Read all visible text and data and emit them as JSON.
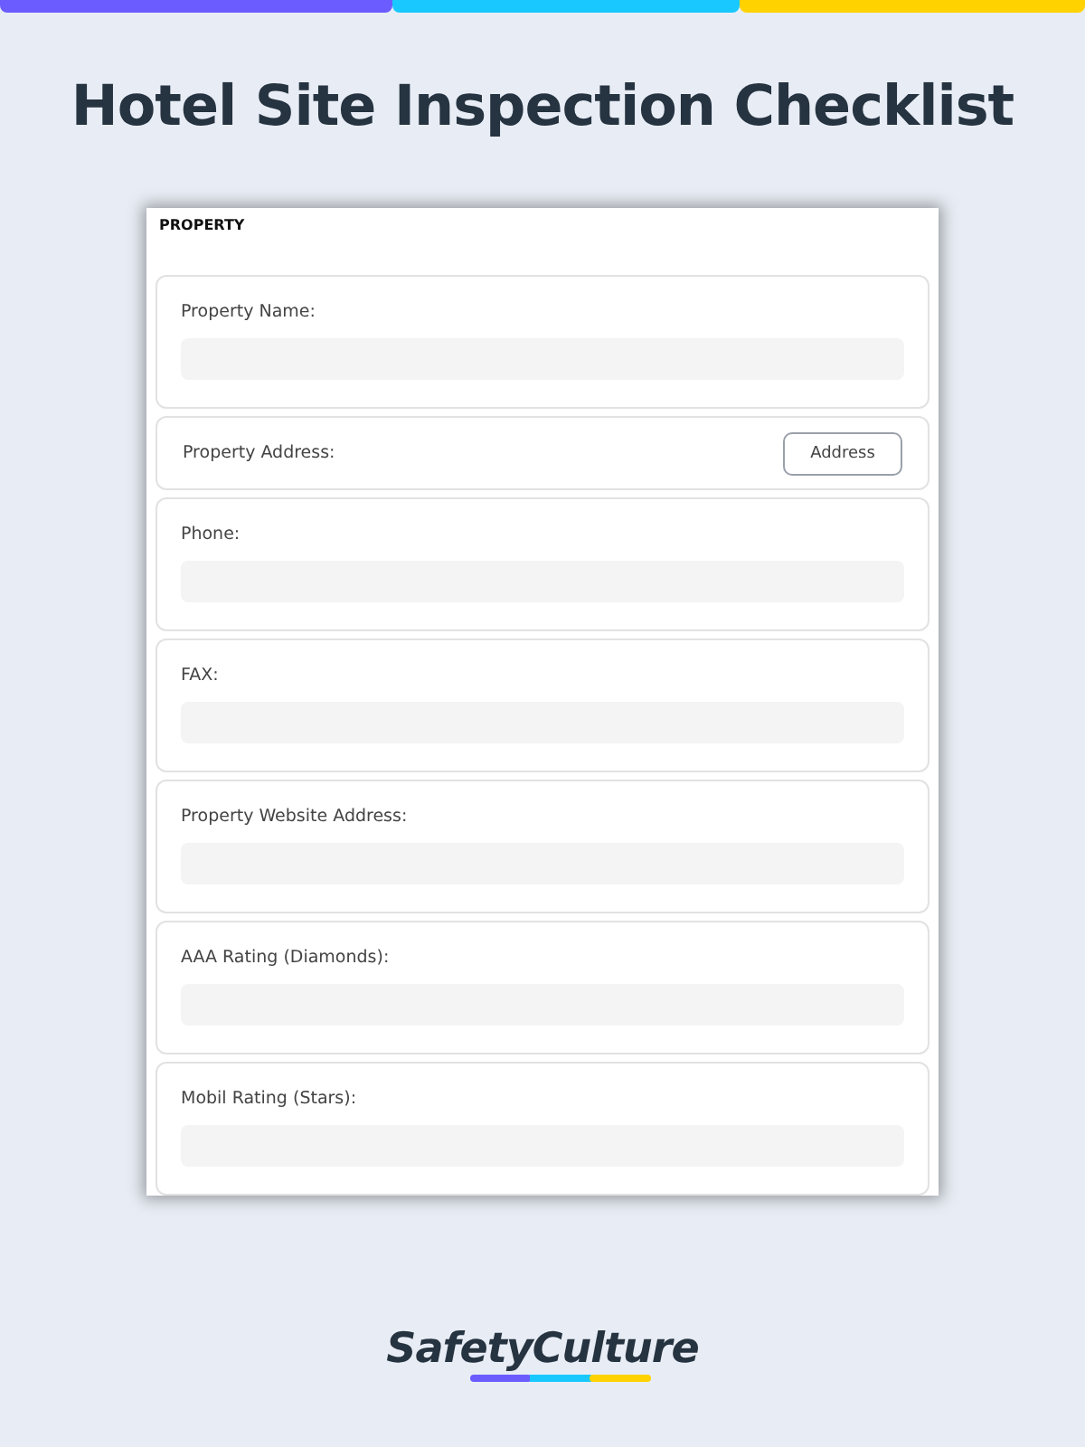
{
  "title": "Hotel Site Inspection Checklist",
  "form": {
    "section": "PROPERTY",
    "questions": [
      {
        "kind": "text",
        "label": "Property Name:"
      },
      {
        "kind": "button",
        "label": "Property Address:",
        "button": "Address"
      },
      {
        "kind": "text",
        "label": "Phone:"
      },
      {
        "kind": "text",
        "label": "FAX:"
      },
      {
        "kind": "text",
        "label": "Property Website Address:"
      },
      {
        "kind": "text",
        "label": "AAA Rating (Diamonds):"
      },
      {
        "kind": "text",
        "label": "Mobil Rating (Stars):"
      }
    ]
  },
  "brand": "SafetyCulture"
}
